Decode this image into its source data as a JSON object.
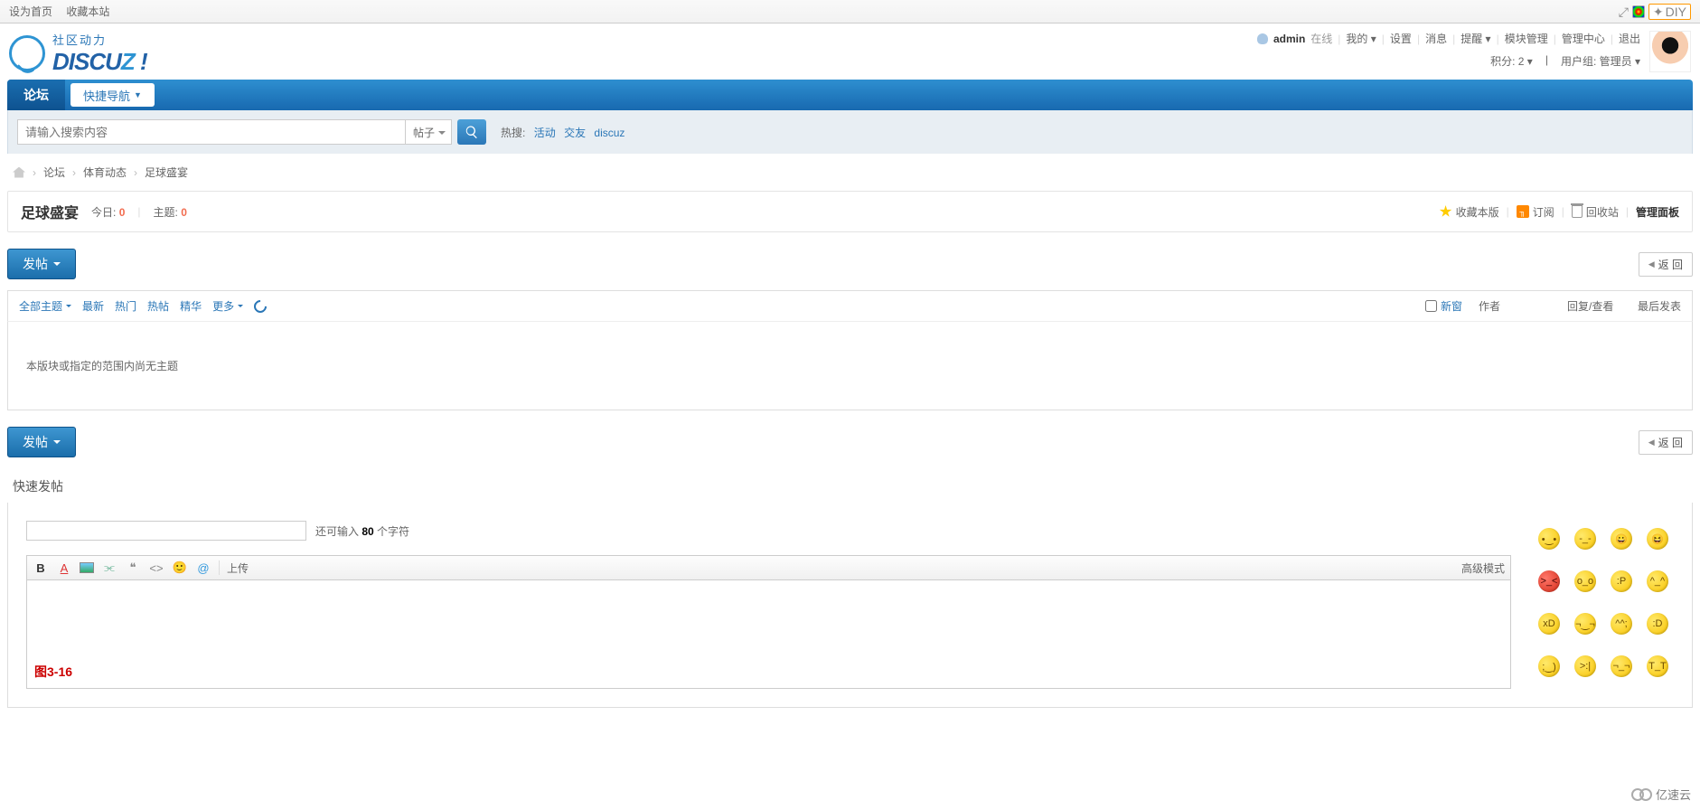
{
  "topbar": {
    "set_home": "设为首页",
    "favorite": "收藏本站",
    "diy": "DIY"
  },
  "logo": {
    "cn": "社区动力",
    "en_pre": "DISCU",
    "en_z": "Z",
    "bang": " !"
  },
  "user": {
    "name": "admin",
    "online": "在线",
    "my": "我的",
    "settings": "设置",
    "msg": "消息",
    "remind": "提醒",
    "module": "模块管理",
    "admin_center": "管理中心",
    "logout": "退出",
    "points_label": "积分:",
    "points": "2",
    "group_label": "用户组:",
    "group": "管理员"
  },
  "nav": {
    "forum": "论坛",
    "quick": "快捷导航"
  },
  "search": {
    "placeholder": "请输入搜索内容",
    "type": "帖子",
    "hot_label": "热搜:",
    "hot1": "活动",
    "hot2": "交友",
    "hot3": "discuz"
  },
  "breadcrumb": {
    "forum": "论坛",
    "cat": "体育动态",
    "board": "足球盛宴"
  },
  "board": {
    "name": "足球盛宴",
    "today_label": "今日:",
    "today": "0",
    "topics_label": "主题:",
    "topics": "0",
    "fav": "收藏本版",
    "sub": "订阅",
    "recycle": "回收站",
    "admin": "管理面板"
  },
  "buttons": {
    "post": "发帖",
    "back": "返 回"
  },
  "filter": {
    "all": "全部主题",
    "new": "最新",
    "hot": "热门",
    "hotpost": "热帖",
    "essence": "精华",
    "more": "更多",
    "newwin": "新窗",
    "author": "作者",
    "reply": "回复/查看",
    "last": "最后发表"
  },
  "empty": "本版块或指定的范围内尚无主题",
  "quick": {
    "title": "快速发帖",
    "remain_pre": "还可输入 ",
    "remain_n": "80",
    "remain_suf": " 个字符",
    "upload": "上传",
    "adv": "高级模式",
    "fig": "图3-16"
  },
  "watermark": "亿速云"
}
